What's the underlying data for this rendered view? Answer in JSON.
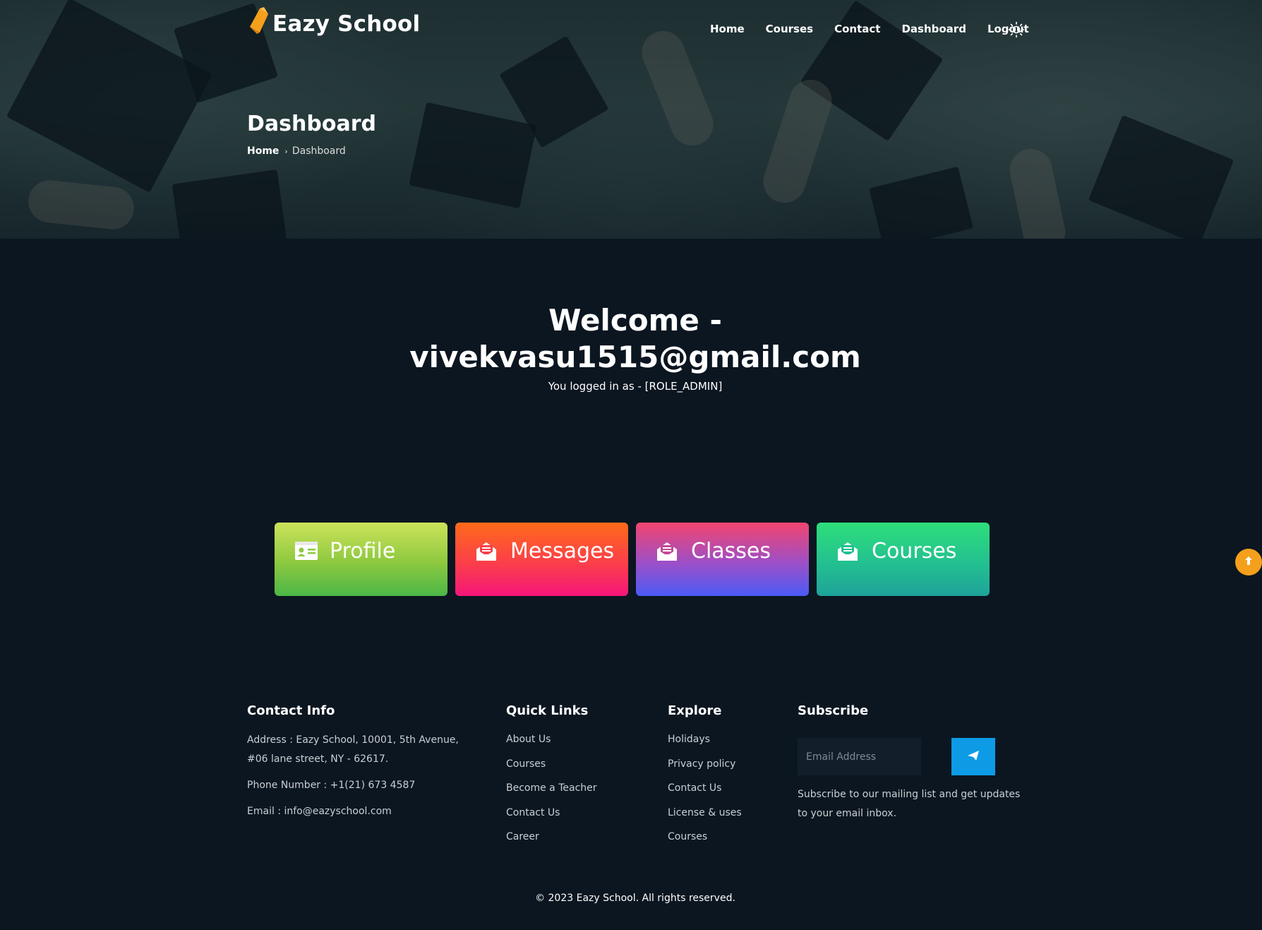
{
  "brand": {
    "name": "Eazy School"
  },
  "nav": {
    "items": [
      {
        "label": "Home"
      },
      {
        "label": "Courses"
      },
      {
        "label": "Contact"
      },
      {
        "label": "Dashboard"
      },
      {
        "label": "Logout"
      }
    ],
    "theme_icon": "sun-icon"
  },
  "hero": {
    "title": "Dashboard",
    "breadcrumb": {
      "home": "Home",
      "separator": "›",
      "current": "Dashboard"
    }
  },
  "welcome": {
    "line1": "Welcome -",
    "line2": "vivekvasu1515@gmail.com",
    "role_text": "You logged in as - [ROLE_ADMIN]"
  },
  "tiles": [
    {
      "label": "Profile",
      "icon": "id-card-icon"
    },
    {
      "label": "Messages",
      "icon": "envelope-open-icon"
    },
    {
      "label": "Classes",
      "icon": "envelope-open-icon"
    },
    {
      "label": "Courses",
      "icon": "envelope-open-icon"
    }
  ],
  "footer": {
    "contact": {
      "title": "Contact Info",
      "address": "Address : Eazy School, 10001, 5th Avenue, #06 lane street, NY - 62617.",
      "phone": "Phone Number : +1(21) 673 4587",
      "email": "Email : info@eazyschool.com"
    },
    "quick_links": {
      "title": "Quick Links",
      "items": [
        "About Us",
        "Courses",
        "Become a Teacher",
        "Contact Us",
        "Career"
      ]
    },
    "explore": {
      "title": "Explore",
      "items": [
        "Holidays",
        "Privacy policy",
        "Contact Us",
        "License & uses",
        "Courses"
      ]
    },
    "subscribe": {
      "title": "Subscribe",
      "placeholder": "Email Address",
      "description": "Subscribe to our mailing list and get updates to your email inbox.",
      "send_icon": "paper-plane-icon"
    },
    "copyright": "© 2023 Eazy School. All rights reserved."
  },
  "colors": {
    "background": "#0b1620",
    "accent_orange": "#f5a01c",
    "send_button": "#0d9be6"
  }
}
